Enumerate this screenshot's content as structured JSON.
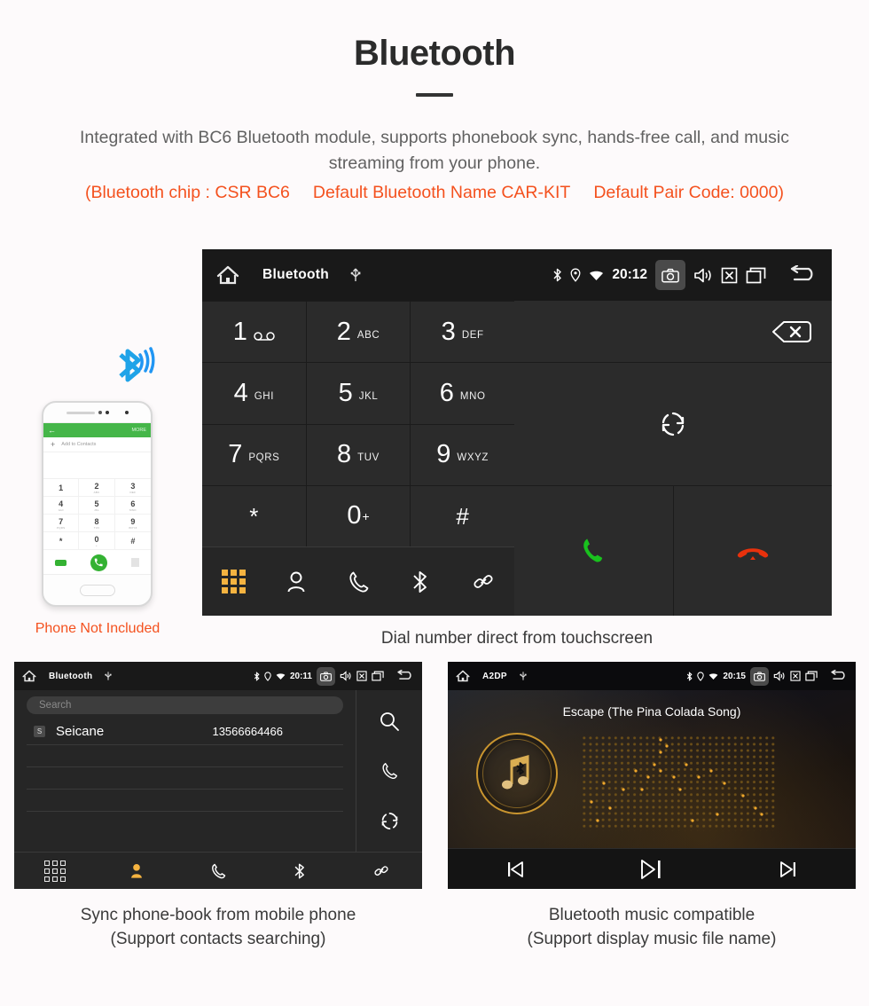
{
  "header": {
    "title": "Bluetooth",
    "description_line1": "Integrated with BC6 Bluetooth module, supports phonebook sync, hands-free call, and",
    "description_line2": "music streaming from your phone.",
    "spec_chip": "(Bluetooth chip : CSR BC6",
    "spec_name": "Default Bluetooth Name CAR-KIT",
    "spec_pair": "Default Pair Code: 0000)",
    "accent_color": "#f4511e",
    "text_color": "#616161"
  },
  "phone_mock": {
    "caption": "Phone Not Included",
    "app_more_label": "MORE",
    "add_contacts_label": "Add to Contacts",
    "keys": [
      {
        "digit": "1",
        "letters": ""
      },
      {
        "digit": "2",
        "letters": "ABC"
      },
      {
        "digit": "3",
        "letters": "DEF"
      },
      {
        "digit": "4",
        "letters": "GHI"
      },
      {
        "digit": "5",
        "letters": "JKL"
      },
      {
        "digit": "6",
        "letters": "MNO"
      },
      {
        "digit": "7",
        "letters": "PQRS"
      },
      {
        "digit": "8",
        "letters": "TUV"
      },
      {
        "digit": "9",
        "letters": "WXYZ"
      },
      {
        "digit": "*",
        "letters": ""
      },
      {
        "digit": "0",
        "letters": "+"
      },
      {
        "digit": "#",
        "letters": ""
      }
    ]
  },
  "dialer": {
    "status": {
      "title": "Bluetooth",
      "time": "20:12",
      "icons": [
        "home-icon",
        "usb-icon",
        "bluetooth-icon",
        "location-icon",
        "wifi-icon",
        "camera-icon",
        "volume-icon",
        "close-box-icon",
        "recents-icon",
        "back-icon"
      ]
    },
    "keys": [
      {
        "digit": "1",
        "letters": "",
        "sub": "voicemail-icon"
      },
      {
        "digit": "2",
        "letters": "ABC"
      },
      {
        "digit": "3",
        "letters": "DEF"
      },
      {
        "digit": "4",
        "letters": "GHI"
      },
      {
        "digit": "5",
        "letters": "JKL"
      },
      {
        "digit": "6",
        "letters": "MNO"
      },
      {
        "digit": "7",
        "letters": "PQRS"
      },
      {
        "digit": "8",
        "letters": "TUV"
      },
      {
        "digit": "9",
        "letters": "WXYZ"
      },
      {
        "digit": "*",
        "letters": ""
      },
      {
        "digit": "0",
        "letters": "+"
      },
      {
        "digit": "#",
        "letters": ""
      }
    ],
    "actions": {
      "backspace": "backspace-icon",
      "sync": "sync-icon",
      "call": "call-icon",
      "hangup": "hangup-icon",
      "call_color": "#19c11e",
      "hangup_color": "#e8310c"
    },
    "nav": [
      "keypad",
      "contacts",
      "call-log",
      "bluetooth",
      "pair"
    ],
    "nav_active": "keypad",
    "active_color": "#f5b340",
    "caption": "Dial number direct from touchscreen"
  },
  "phonebook": {
    "status": {
      "title": "Bluetooth",
      "time": "20:11"
    },
    "search_placeholder": "Search",
    "contacts": [
      {
        "initial": "S",
        "name": "Seicane",
        "number": "13566664466"
      }
    ],
    "side_icons": [
      "search-icon",
      "call-icon",
      "sync-icon"
    ],
    "nav": [
      "keypad",
      "contacts",
      "call-log",
      "bluetooth",
      "pair"
    ],
    "nav_active": "contacts",
    "caption_line1": "Sync phone-book from mobile phone",
    "caption_line2": "(Support contacts searching)"
  },
  "music": {
    "status": {
      "title": "A2DP",
      "time": "20:15"
    },
    "song_title": "Escape (The Pina Colada Song)",
    "controls": [
      "previous-icon",
      "play-pause-icon",
      "next-icon"
    ],
    "accent_color": "#c9952f",
    "caption_line1": "Bluetooth music compatible",
    "caption_line2": "(Support display music file name)"
  }
}
